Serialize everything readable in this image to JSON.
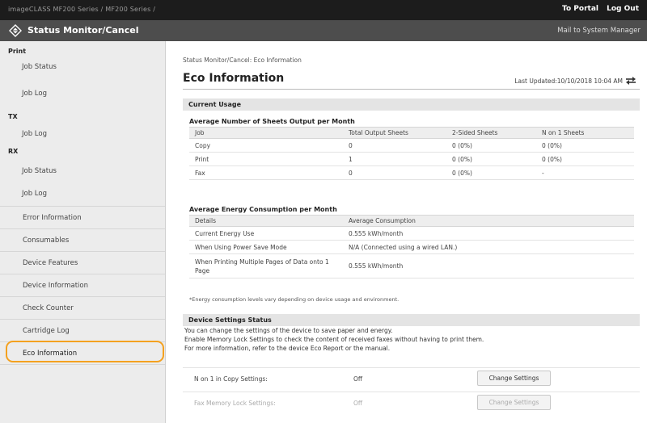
{
  "topbar": {
    "breadcrumb": "imageCLASS  MF200 Series / MF200 Series /",
    "to_portal": "To Portal",
    "log_out": "Log Out"
  },
  "titlebar": {
    "title": "Status Monitor/Cancel",
    "mail": "Mail to System Manager"
  },
  "sidebar": {
    "print_heading": "Print",
    "print_job_status": "Job Status",
    "print_job_log": "Job Log",
    "tx_heading": "TX",
    "tx_job_log": "Job Log",
    "rx_heading": "RX",
    "rx_job_status": "Job Status",
    "rx_job_log": "Job Log",
    "error_information": "Error Information",
    "consumables": "Consumables",
    "device_features": "Device Features",
    "device_information": "Device Information",
    "check_counter": "Check Counter",
    "cartridge_log": "Cartridge Log",
    "eco_information": "Eco Information"
  },
  "main": {
    "breadcrumb": "Status Monitor/Cancel: Eco Information",
    "title": "Eco Information",
    "last_updated": "Last Updated:10/10/2018 10:04 AM",
    "current_usage": "Current Usage",
    "sheets_title": "Average Number of Sheets Output per Month",
    "sheets_headers": [
      "Job",
      "Total Output Sheets",
      "2-Sided Sheets",
      "N on 1 Sheets"
    ],
    "sheets_rows": [
      [
        "Copy",
        "0",
        "0 (0%)",
        "0 (0%)"
      ],
      [
        "Print",
        "1",
        "0 (0%)",
        "0 (0%)"
      ],
      [
        "Fax",
        "0",
        "0 (0%)",
        "-"
      ]
    ],
    "energy_title": "Average Energy Consumption per Month",
    "energy_headers": [
      "Details",
      "Average Consumption"
    ],
    "energy_rows": [
      [
        "Current Energy Use",
        "0.555  kWh/month"
      ],
      [
        "When Using Power Save Mode",
        "N/A (Connected using a wired LAN.)"
      ],
      [
        "When Printing Multiple Pages of Data onto 1 Page",
        "0.555  kWh/month"
      ]
    ],
    "energy_note": "*Energy consumption levels vary depending on device usage and environment.",
    "device_settings_status": "Device Settings Status",
    "desc_line1": "You can change the settings of the device to save paper and energy.",
    "desc_line2": "Enable Memory Lock Settings to check the content of received faxes without having to print them.",
    "desc_line3": "For more information, refer to the device Eco Report or the manual.",
    "settings": [
      {
        "label": "N on 1 in Copy Settings:",
        "value": "Off",
        "button": "Change Settings"
      },
      {
        "label": "Fax Memory Lock Settings:",
        "value": "Off",
        "button": "Change Settings"
      }
    ]
  },
  "colors": {
    "topbar": "#1c1c1c",
    "titlebar": "#4d4d4d",
    "sidebar": "#ececec",
    "highlight": "#f4a11f"
  },
  "icons": {
    "logo": "status-monitor-logo-icon",
    "refresh": "refresh-icon"
  }
}
